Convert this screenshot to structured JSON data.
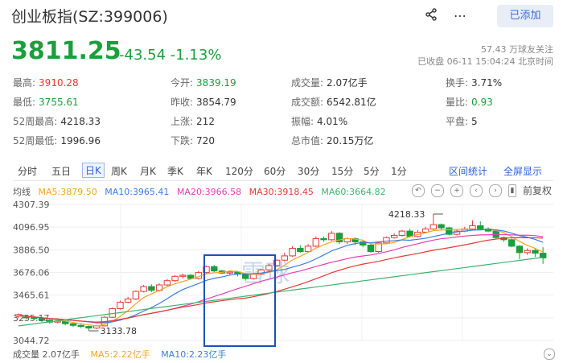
{
  "header": {
    "title": "创业板指(SZ:399006)",
    "added_label": "已添加"
  },
  "quote": {
    "price": "3811.25",
    "change": "-43.54",
    "change_pct": "-1.13%",
    "followers": "57.43 万球友关注",
    "status": "已收盘 06-11 15:04:24 北京时间"
  },
  "stats": {
    "high_label": "最高:",
    "high": "3910.28",
    "open_label": "今开:",
    "open": "3839.19",
    "volume_label": "成交量:",
    "volume": "2.07亿手",
    "turnover_label": "换手:",
    "turnover": "3.71%",
    "low_label": "最低:",
    "low": "3755.61",
    "prevclose_label": "昨收:",
    "prevclose": "3854.79",
    "amount_label": "成交额:",
    "amount": "6542.81亿",
    "volratio_label": "量比:",
    "volratio": "0.93",
    "w52high_label": "52周最高:",
    "w52high": "4218.33",
    "up_label": "上涨:",
    "up": "212",
    "amplitude_label": "振幅:",
    "amplitude": "4.01%",
    "flat_label": "平盘:",
    "flat": "5",
    "w52low_label": "52周最低:",
    "w52low": "1996.96",
    "down_label": "下跌:",
    "down": "720",
    "mcap_label": "总市值:",
    "mcap": "20.15万亿"
  },
  "tabs": [
    "分时",
    "五日",
    "日K",
    "周K",
    "月K",
    "季K",
    "年K",
    "120分",
    "60分",
    "30分",
    "15分",
    "5分",
    "1分"
  ],
  "tab_tools": [
    "区间统计",
    "全屏显示"
  ],
  "ma_legend": {
    "label": "均线",
    "ma5": "MA5:3879.50",
    "ma10": "MA10:3965.41",
    "ma20": "MA20:3966.58",
    "ma30": "MA30:3918.45",
    "ma60": "MA60:3664.82"
  },
  "ma_colors": {
    "ma5": "#f5a623",
    "ma10": "#3b7ddd",
    "ma20": "#e53fb5",
    "ma30": "#e53935",
    "ma60": "#3cb371"
  },
  "controls": {
    "adjust_label": "前复权"
  },
  "chart_data": {
    "type": "candlestick",
    "y_ticks": [
      "4307.39",
      "4096.95",
      "3886.50",
      "3676.06",
      "3465.61",
      "3255.17",
      "3044.72"
    ],
    "ylim": [
      3044.72,
      4307.39
    ],
    "annot_high": "4218.33",
    "annot_low": "3133.78",
    "watermark": "雪球",
    "candles": [
      [
        3270,
        3285,
        3250,
        3295
      ],
      [
        3262,
        3255,
        3240,
        3275
      ],
      [
        3255,
        3250,
        3235,
        3265
      ],
      [
        3250,
        3232,
        3215,
        3258
      ],
      [
        3232,
        3215,
        3200,
        3240
      ],
      [
        3215,
        3225,
        3205,
        3240
      ],
      [
        3225,
        3200,
        3185,
        3232
      ],
      [
        3200,
        3185,
        3170,
        3210
      ],
      [
        3185,
        3175,
        3160,
        3195
      ],
      [
        3175,
        3160,
        3134,
        3182
      ],
      [
        3160,
        3180,
        3150,
        3190
      ],
      [
        3180,
        3260,
        3175,
        3270
      ],
      [
        3260,
        3340,
        3255,
        3350
      ],
      [
        3340,
        3400,
        3330,
        3415
      ],
      [
        3400,
        3430,
        3390,
        3450
      ],
      [
        3430,
        3500,
        3420,
        3510
      ],
      [
        3500,
        3545,
        3490,
        3560
      ],
      [
        3545,
        3510,
        3495,
        3565
      ],
      [
        3510,
        3560,
        3500,
        3575
      ],
      [
        3560,
        3600,
        3550,
        3615
      ],
      [
        3600,
        3640,
        3590,
        3650
      ],
      [
        3640,
        3650,
        3620,
        3665
      ],
      [
        3650,
        3620,
        3610,
        3660
      ],
      [
        3620,
        3675,
        3610,
        3690
      ],
      [
        3675,
        3730,
        3660,
        3740
      ],
      [
        3730,
        3690,
        3680,
        3745
      ],
      [
        3690,
        3670,
        3660,
        3700
      ],
      [
        3670,
        3680,
        3655,
        3695
      ],
      [
        3680,
        3660,
        3640,
        3690
      ],
      [
        3660,
        3620,
        3600,
        3670
      ],
      [
        3620,
        3660,
        3610,
        3670
      ],
      [
        3660,
        3700,
        3650,
        3710
      ],
      [
        3700,
        3740,
        3690,
        3755
      ],
      [
        3740,
        3790,
        3730,
        3800
      ],
      [
        3790,
        3830,
        3780,
        3860
      ],
      [
        3830,
        3900,
        3820,
        3920
      ],
      [
        3900,
        3870,
        3860,
        3930
      ],
      [
        3870,
        3920,
        3860,
        3940
      ],
      [
        3920,
        3990,
        3910,
        4010
      ],
      [
        3990,
        3980,
        3960,
        4010
      ],
      [
        3980,
        4040,
        3970,
        4060
      ],
      [
        4040,
        3960,
        3940,
        4050
      ],
      [
        3960,
        3990,
        3940,
        4000
      ],
      [
        3990,
        3960,
        3930,
        4000
      ],
      [
        3960,
        3930,
        3910,
        3975
      ],
      [
        3930,
        3870,
        3860,
        3945
      ],
      [
        3870,
        3950,
        3860,
        3960
      ],
      [
        3950,
        4000,
        3940,
        4010
      ],
      [
        4000,
        4020,
        3990,
        4040
      ],
      [
        4020,
        4060,
        4010,
        4070
      ],
      [
        4060,
        4010,
        4000,
        4080
      ],
      [
        4010,
        4050,
        4000,
        4070
      ],
      [
        4050,
        4080,
        4040,
        4100
      ],
      [
        4080,
        4120,
        4070,
        4218
      ],
      [
        4120,
        4090,
        4070,
        4130
      ],
      [
        4090,
        4030,
        4020,
        4100
      ],
      [
        4030,
        4060,
        4020,
        4080
      ],
      [
        4060,
        4080,
        4050,
        4100
      ],
      [
        4080,
        4110,
        4070,
        4160
      ],
      [
        4110,
        4080,
        4070,
        4150
      ],
      [
        4080,
        4060,
        4050,
        4095
      ],
      [
        4060,
        4000,
        3990,
        4075
      ],
      [
        4000,
        3980,
        3960,
        4010
      ],
      [
        3980,
        3920,
        3910,
        3990
      ],
      [
        3920,
        3860,
        3800,
        3930
      ],
      [
        3860,
        3880,
        3840,
        3900
      ],
      [
        3880,
        3855,
        3820,
        3900
      ],
      [
        3855,
        3811,
        3756,
        3910
      ]
    ]
  },
  "volume": {
    "label": "成交量 2.07亿手",
    "ma5": "MA5:2.22亿手",
    "ma10": "MA10:2.23亿手"
  }
}
